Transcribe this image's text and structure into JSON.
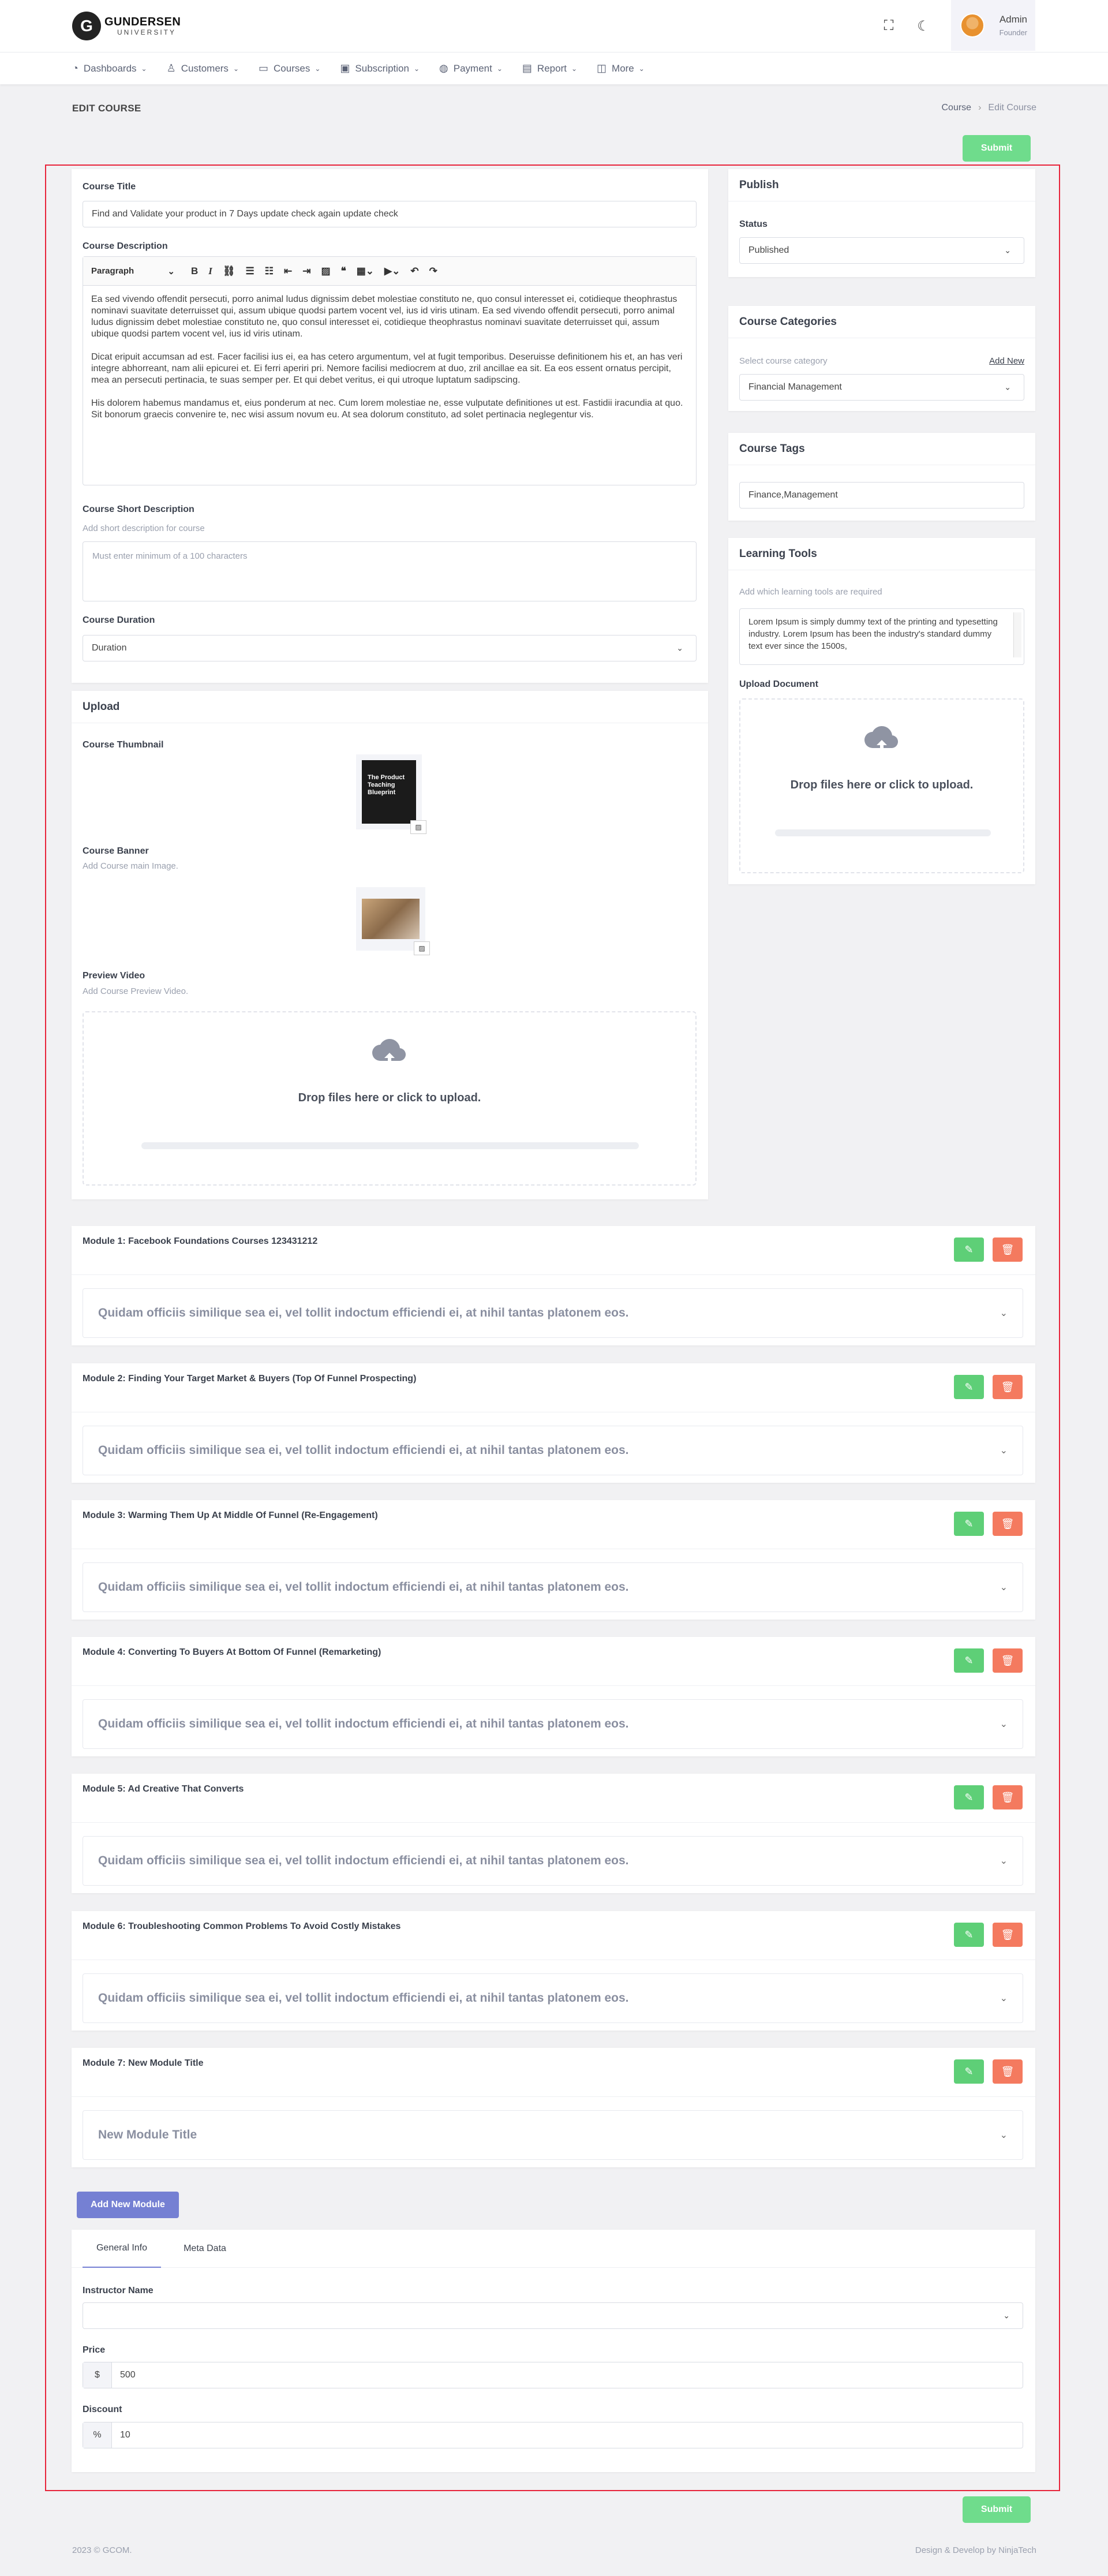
{
  "brand": {
    "name": "GUNDERSEN",
    "sub": "UNIVERSITY",
    "icons": [
      "fullscreen-icon",
      "moon-icon"
    ]
  },
  "user": {
    "name": "Admin",
    "role": "Founder"
  },
  "nav": [
    {
      "label": "Dashboards",
      "icon": "dashboard-icon"
    },
    {
      "label": "Customers",
      "icon": "user-icon"
    },
    {
      "label": "Courses",
      "icon": "laptop-icon"
    },
    {
      "label": "Subscription",
      "icon": "subscription-icon"
    },
    {
      "label": "Payment",
      "icon": "payment-icon"
    },
    {
      "label": "Report",
      "icon": "report-icon"
    },
    {
      "label": "More",
      "icon": "briefcase-icon"
    }
  ],
  "page": {
    "title": "EDIT COURSE",
    "breadcrumb": [
      "Course",
      "Edit Course"
    ],
    "submit": "Submit"
  },
  "course": {
    "title_label": "Course Title",
    "title_value": "Find and Validate your product in 7 Days update check again update check",
    "desc_label": "Course Description",
    "toolbar_paragraph": "Paragraph",
    "desc_paragraphs": [
      "Ea sed vivendo offendit persecuti, porro animal ludus dignissim debet molestiae constituto ne, quo consul interesset ei, cotidieque theophrastus nominavi suavitate deterruisset qui, assum ubique quodsi partem vocent vel, ius id viris utinam. Ea sed vivendo offendit persecuti, porro animal ludus dignissim debet molestiae constituto ne, quo consul interesset ei, cotidieque theophrastus nominavi suavitate deterruisset qui, assum ubique quodsi partem vocent vel, ius id viris utinam.",
      "Dicat eripuit accumsan ad est. Facer facilisi ius ei, ea has cetero argumentum, vel at fugit temporibus. Deseruisse definitionem his et, an has veri integre abhorreant, nam alii epicurei et. Ei ferri aperiri pri. Nemore facilisi mediocrem at duo, zril ancillae ea sit. Ea eos essent ornatus percipit, mea an persecuti pertinacia, te suas semper per. Et qui debet veritus, ei qui utroque luptatum sadipscing.",
      "His dolorem habemus mandamus et, eius ponderum at nec. Cum lorem molestiae ne, esse vulputate definitiones ut est. Fastidii iracundia at quo. Sit bonorum graecis convenire te, nec wisi assum novum eu. At sea dolorum constituto, ad solet pertinacia neglegentur vis."
    ],
    "short_label": "Course Short Description",
    "short_hint": "Add short description for course",
    "short_placeholder": "Must enter minimum of a 100 characters",
    "duration_label": "Course Duration",
    "duration_value": "Duration"
  },
  "upload": {
    "title": "Upload",
    "thumb_label": "Course Thumbnail",
    "thumb_text": "The Product Teaching Blueprint",
    "banner_label": "Course Banner",
    "banner_hint": "Add Course main Image.",
    "video_label": "Preview Video",
    "video_hint": "Add Course Preview Video.",
    "drop_text": "Drop files here or click to upload."
  },
  "publish": {
    "title": "Publish",
    "status_label": "Status",
    "status_value": "Published"
  },
  "categories": {
    "title": "Course Categories",
    "hint": "Select course category",
    "add_new": "Add New",
    "value": "Financial Management"
  },
  "tags": {
    "title": "Course Tags",
    "value": "Finance,Management"
  },
  "tools": {
    "title": "Learning Tools",
    "hint": "Add which learning tools are required",
    "value": "Lorem Ipsum is simply dummy text of the printing and typesetting industry. Lorem Ipsum has been the industry's standard dummy text ever since the 1500s,",
    "doc_label": "Upload Document",
    "drop_text": "Drop files here or click to upload."
  },
  "modules": [
    {
      "title": "Module 1: Facebook Foundations Courses 123431212",
      "body": "Quidam officiis similique sea ei, vel tollit indoctum efficiendi ei, at nihil tantas platonem eos."
    },
    {
      "title": "Module 2: Finding Your Target Market & Buyers (Top Of Funnel Prospecting)",
      "body": "Quidam officiis similique sea ei, vel tollit indoctum efficiendi ei, at nihil tantas platonem eos."
    },
    {
      "title": "Module 3: Warming Them Up At Middle Of Funnel (Re-Engagement)",
      "body": "Quidam officiis similique sea ei, vel tollit indoctum efficiendi ei, at nihil tantas platonem eos."
    },
    {
      "title": "Module 4: Converting To Buyers At Bottom Of Funnel (Remarketing)",
      "body": "Quidam officiis similique sea ei, vel tollit indoctum efficiendi ei, at nihil tantas platonem eos."
    },
    {
      "title": "Module 5: Ad Creative That Converts",
      "body": "Quidam officiis similique sea ei, vel tollit indoctum efficiendi ei, at nihil tantas platonem eos."
    },
    {
      "title": "Module 6: Troubleshooting Common Problems To Avoid Costly Mistakes",
      "body": "Quidam officiis similique sea ei, vel tollit indoctum efficiendi ei, at nihil tantas platonem eos."
    },
    {
      "title": "Module 7: New Module Title",
      "body": "New Module Title"
    }
  ],
  "add_module": "Add New Module",
  "info": {
    "tabs": [
      "General Info",
      "Meta Data"
    ],
    "instructor_label": "Instructor Name",
    "price_label": "Price",
    "price_prefix": "$",
    "price_value": "500",
    "discount_label": "Discount",
    "discount_prefix": "%",
    "discount_value": "10"
  },
  "footer": {
    "left": "2023 © GCOM.",
    "right": "Design & Develop by NinjaTech"
  },
  "colors": {
    "accent": "#7580d3",
    "submit": "#6fdc8c",
    "edit": "#5ecf77",
    "delete": "#f47a5f",
    "frame": "#e8243a"
  }
}
